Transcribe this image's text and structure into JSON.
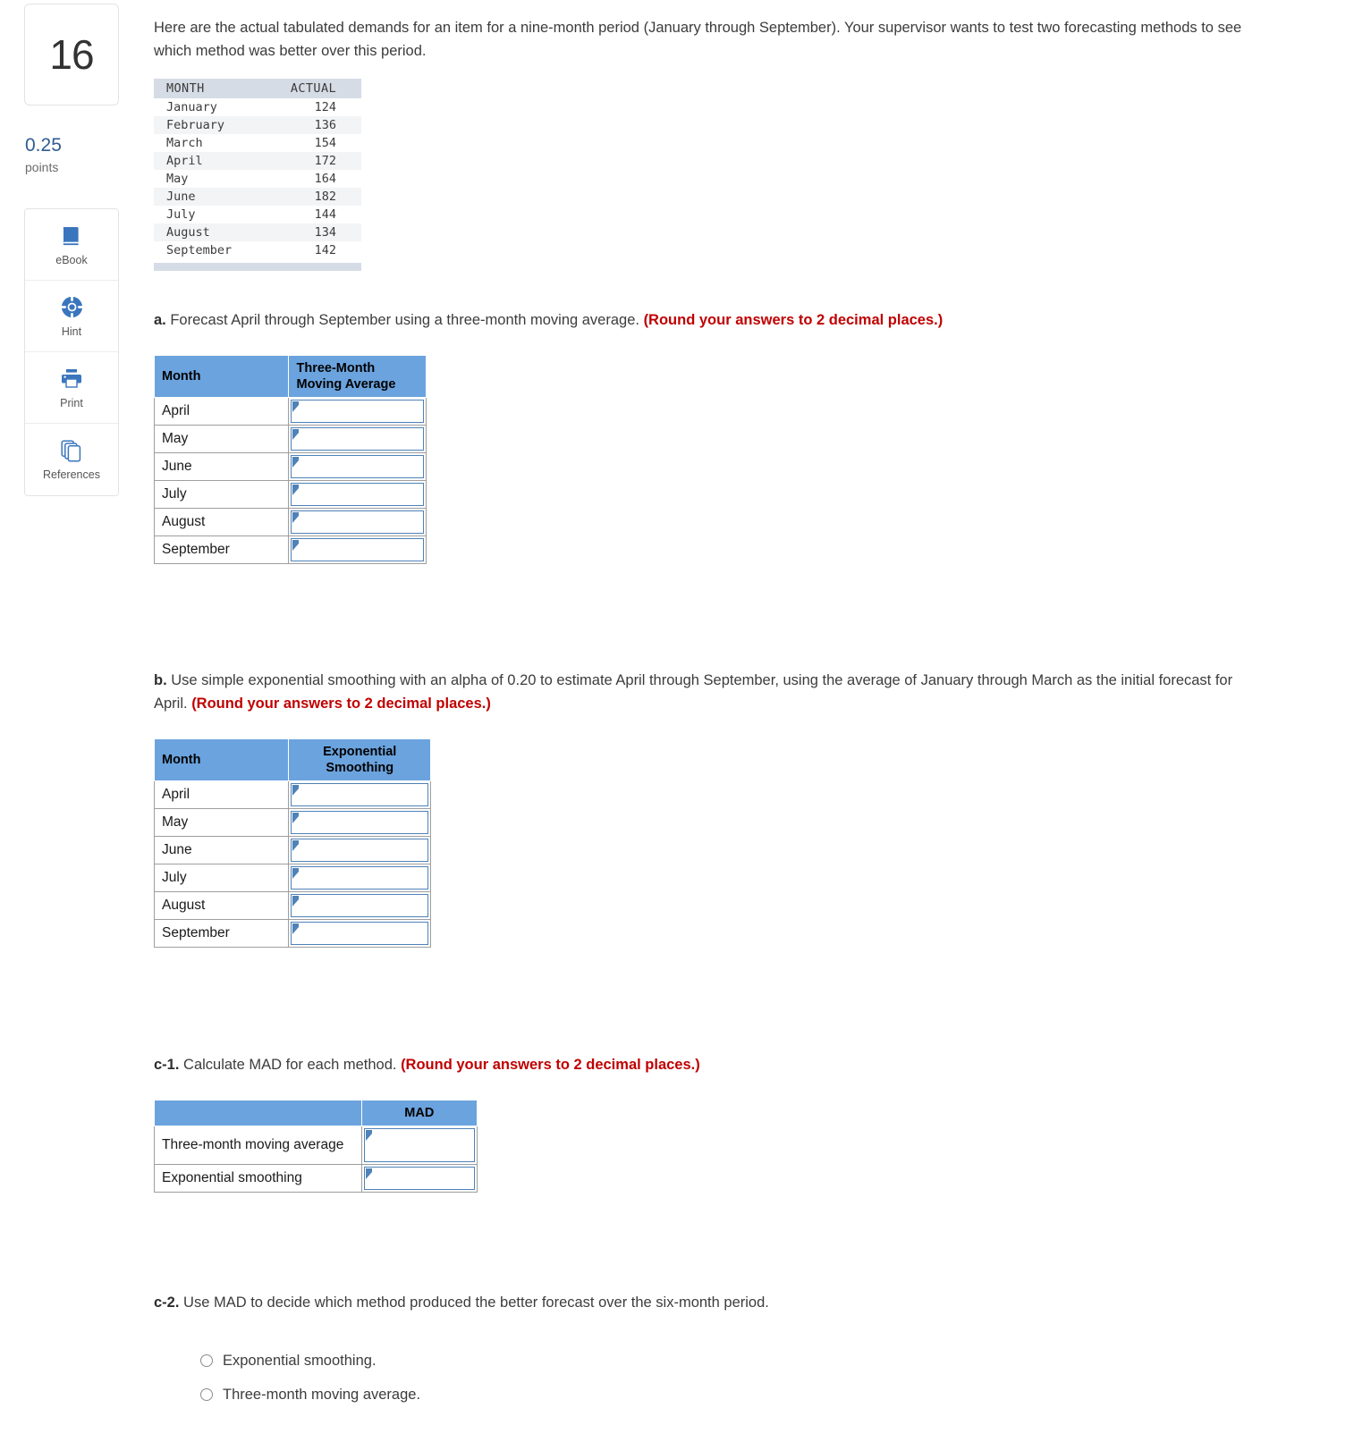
{
  "question": {
    "number": "16",
    "points_value": "0.25",
    "points_label": "points"
  },
  "tools": [
    {
      "label": "eBook",
      "icon": "book-icon"
    },
    {
      "label": "Hint",
      "icon": "life-ring-icon"
    },
    {
      "label": "Print",
      "icon": "printer-icon"
    },
    {
      "label": "References",
      "icon": "pages-stack-icon"
    }
  ],
  "intro": "Here are the actual tabulated demands for an item for a nine-month period (January through September). Your supervisor wants to test two forecasting methods to see which method was better over this period.",
  "demand_table": {
    "headers": [
      "MONTH",
      "ACTUAL"
    ],
    "rows": [
      {
        "month": "January",
        "actual": "124"
      },
      {
        "month": "February",
        "actual": "136"
      },
      {
        "month": "March",
        "actual": "154"
      },
      {
        "month": "April",
        "actual": "172"
      },
      {
        "month": "May",
        "actual": "164"
      },
      {
        "month": "June",
        "actual": "182"
      },
      {
        "month": "July",
        "actual": "144"
      },
      {
        "month": "August",
        "actual": "134"
      },
      {
        "month": "September",
        "actual": "142"
      }
    ]
  },
  "part_a": {
    "marker": "a.",
    "text": " Forecast April through September using a three-month moving average. ",
    "note": "(Round your answers to 2 decimal places.)",
    "table": {
      "header_month": "Month",
      "header_value": "Three-Month Moving Average",
      "rows": [
        "April",
        "May",
        "June",
        "July",
        "August",
        "September"
      ],
      "values": [
        "",
        "",
        "",
        "",
        "",
        ""
      ]
    }
  },
  "part_b": {
    "marker": "b.",
    "text": " Use simple exponential smoothing with an alpha of  0.20 to estimate April through September, using the average of January through March as the initial forecast for April. ",
    "note": "(Round your answers to 2 decimal places.)",
    "table": {
      "header_month": "Month",
      "header_value": "Exponential Smoothing",
      "rows": [
        "April",
        "May",
        "June",
        "July",
        "August",
        "September"
      ],
      "values": [
        "",
        "",
        "",
        "",
        "",
        ""
      ]
    }
  },
  "part_c1": {
    "marker": "c-1.",
    "text": " Calculate MAD for each method. ",
    "note": "(Round your answers to 2 decimal places.)",
    "table": {
      "header_blank": "",
      "header_value": "MAD",
      "rows": [
        "Three-month moving average",
        "Exponential smoothing"
      ],
      "values": [
        "",
        ""
      ]
    }
  },
  "part_c2": {
    "marker": "c-2.",
    "text": " Use MAD to decide which method produced the better forecast over the six-month period.",
    "options": [
      "Exponential smoothing.",
      "Three-month moving average."
    ]
  },
  "colors": {
    "header_blue": "#6ba3de",
    "input_border": "#4f82b8",
    "points_blue": "#2f5c92",
    "note_red": "#c00000",
    "demand_header": "#d6dce5"
  }
}
